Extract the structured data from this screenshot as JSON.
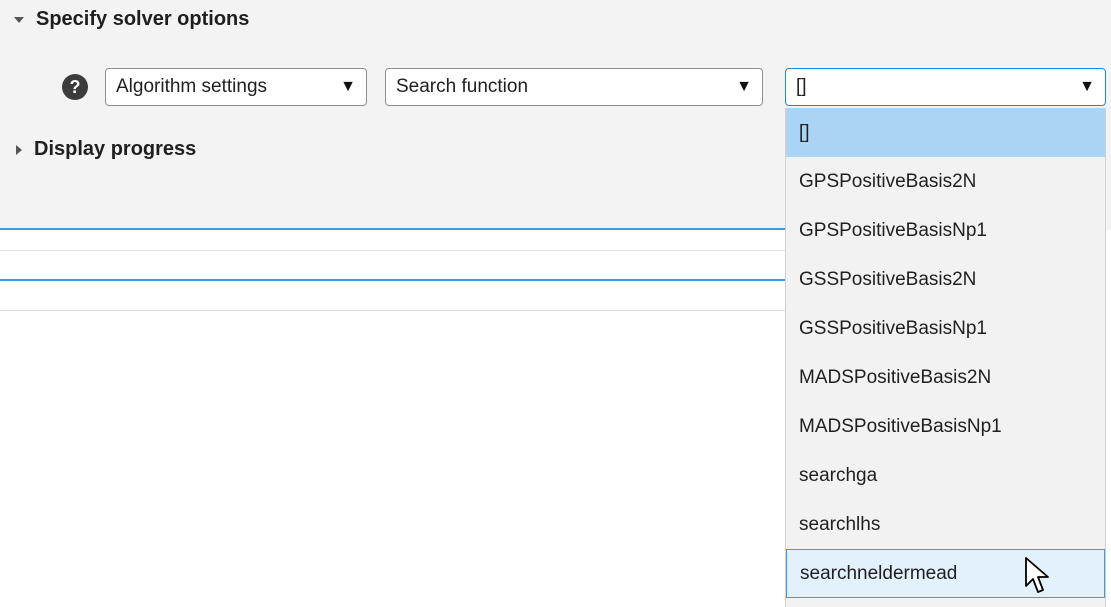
{
  "sections": {
    "solver_options": {
      "label": "Specify solver options",
      "expanded": true
    },
    "display_progress": {
      "label": "Display progress",
      "expanded": false
    }
  },
  "toolbar": {
    "help_icon": "?",
    "category_dropdown": {
      "value": "Algorithm settings",
      "arrow": "▼"
    },
    "option_dropdown": {
      "value": "Search function",
      "arrow": "▼"
    },
    "value_dropdown": {
      "value": "[]",
      "arrow": "▼"
    }
  },
  "dropdown_list": {
    "items": [
      {
        "label": "[]",
        "state": "selected"
      },
      {
        "label": "GPSPositiveBasis2N",
        "state": ""
      },
      {
        "label": "GPSPositiveBasisNp1",
        "state": ""
      },
      {
        "label": "GSSPositiveBasis2N",
        "state": ""
      },
      {
        "label": "GSSPositiveBasisNp1",
        "state": ""
      },
      {
        "label": "MADSPositiveBasis2N",
        "state": ""
      },
      {
        "label": "MADSPositiveBasisNp1",
        "state": ""
      },
      {
        "label": "searchga",
        "state": ""
      },
      {
        "label": "searchlhs",
        "state": ""
      },
      {
        "label": "searchneldermead",
        "state": "hovered"
      }
    ]
  },
  "colors": {
    "panel_bg": "#f3f3f3",
    "selected_bg": "#a9d4f5",
    "hover_bg": "#e3f1fc",
    "accent": "#1a8ae0"
  }
}
